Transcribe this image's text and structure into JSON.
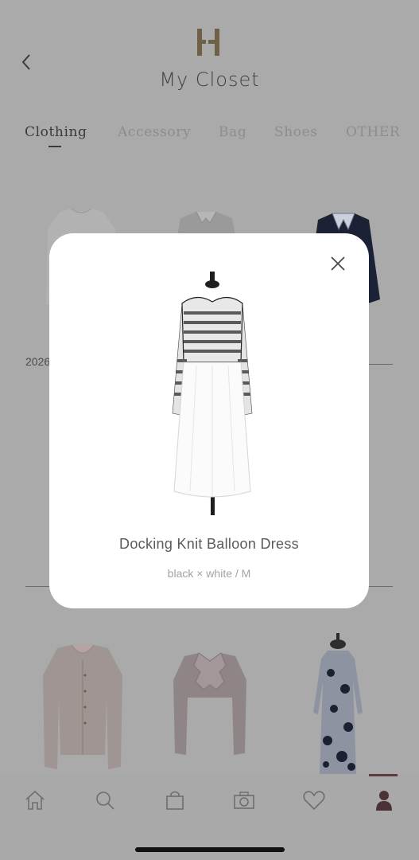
{
  "header": {
    "title": "My Closet",
    "logo_letter": "H"
  },
  "tabs": [
    {
      "label": "Clothing",
      "active": true
    },
    {
      "label": "Accessory",
      "active": false
    },
    {
      "label": "Bag",
      "active": false
    },
    {
      "label": "Shoes",
      "active": false
    },
    {
      "label": "OTHER",
      "active": false
    }
  ],
  "section": {
    "date_partial": "2026"
  },
  "modal": {
    "item_name": "Docking Knit Balloon Dress",
    "item_details": "black × white / M"
  },
  "bottom_nav": {
    "items": [
      "home-icon",
      "search-icon",
      "shopping-bag-icon",
      "camera-icon",
      "heart-icon",
      "user-icon"
    ],
    "active_index": 5
  },
  "colors": {
    "overlay_bg": "#aaaaaa",
    "brand": "#6b5b3a",
    "active_nav": "#5a3b3f"
  }
}
